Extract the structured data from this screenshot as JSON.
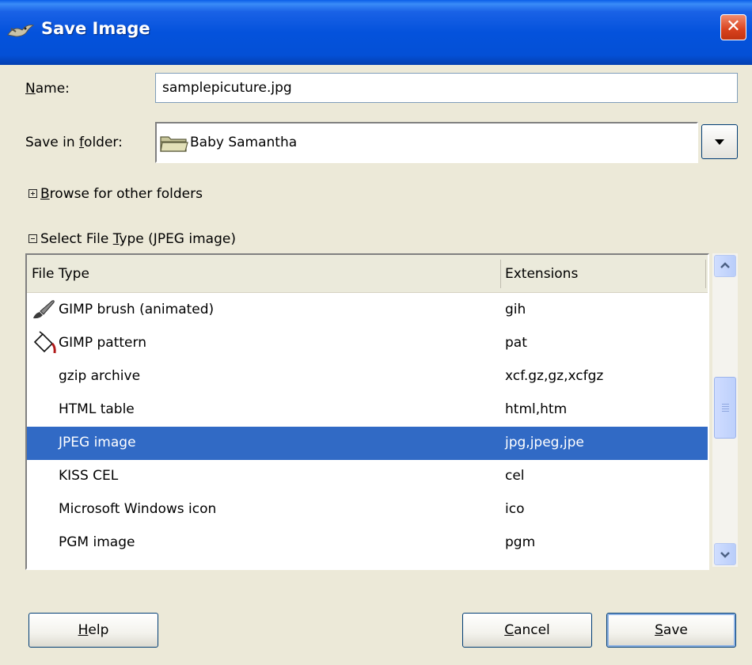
{
  "window": {
    "title": "Save Image",
    "close_label": "✕",
    "app_icon": "gimp-wilber-icon"
  },
  "name": {
    "label_ul": "N",
    "label_rest": "ame:",
    "value": "samplepicuture.jpg"
  },
  "folder": {
    "label_pre": "Save in ",
    "label_ul": "f",
    "label_post": "older:",
    "value": "Baby Samantha",
    "icon": "folder-icon"
  },
  "browse": {
    "label_ul": "B",
    "label_rest": "rowse for other folders",
    "expanded": false
  },
  "filetype": {
    "label_pre": "Select File ",
    "label_ul": "T",
    "label_post": "ype (JPEG image)",
    "expanded": true
  },
  "table": {
    "columns": [
      "File Type",
      "Extensions"
    ],
    "rows": [
      {
        "name": "GIMP brush (animated)",
        "ext": "gih",
        "icon": "brush-icon",
        "selected": false
      },
      {
        "name": "GIMP pattern",
        "ext": "pat",
        "icon": "bucket-fill-icon",
        "selected": false
      },
      {
        "name": "gzip archive",
        "ext": "xcf.gz,gz,xcfgz",
        "icon": "",
        "selected": false
      },
      {
        "name": "HTML table",
        "ext": "html,htm",
        "icon": "",
        "selected": false
      },
      {
        "name": "JPEG image",
        "ext": "jpg,jpeg,jpe",
        "icon": "",
        "selected": true
      },
      {
        "name": "KISS CEL",
        "ext": "cel",
        "icon": "",
        "selected": false
      },
      {
        "name": "Microsoft Windows icon",
        "ext": "ico",
        "icon": "",
        "selected": false
      },
      {
        "name": "PGM image",
        "ext": "pgm",
        "icon": "",
        "selected": false
      }
    ]
  },
  "buttons": {
    "help_ul": "H",
    "help_rest": "elp",
    "cancel_ul": "C",
    "cancel_rest": "ancel",
    "save_ul": "S",
    "save_rest": "ave"
  },
  "colors": {
    "titlebar": "#0452dc",
    "selection": "#316ac5",
    "dialog_bg": "#ece9d8"
  }
}
